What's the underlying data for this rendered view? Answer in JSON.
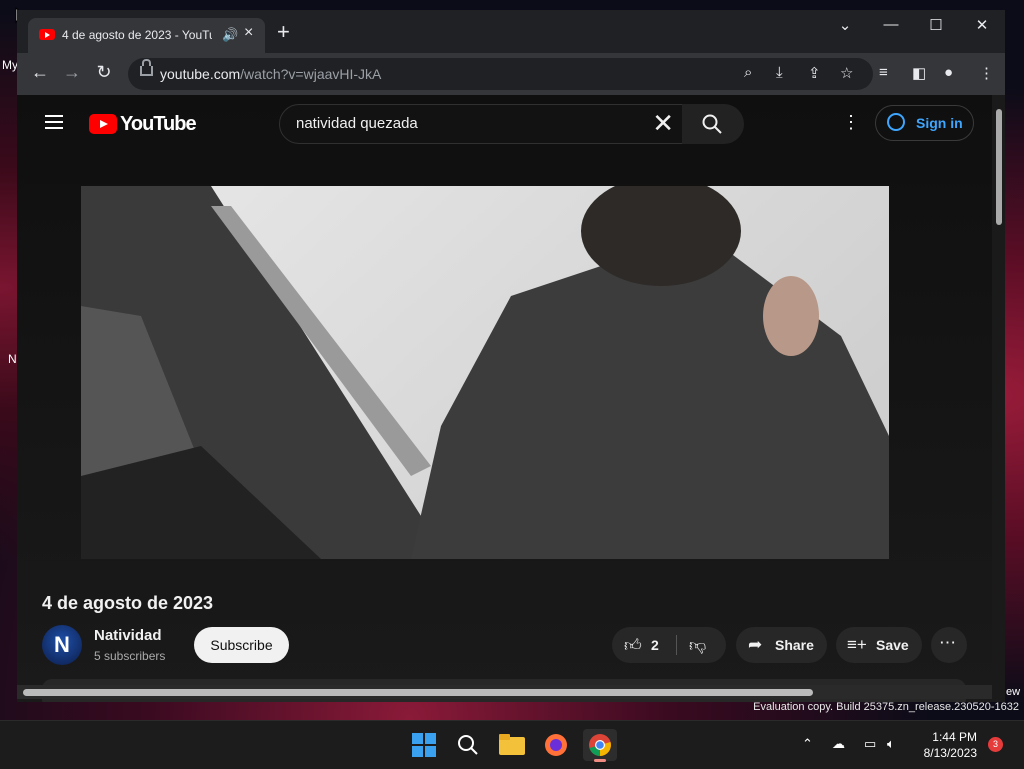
{
  "desktop": {
    "fragments": [
      "My",
      "N",
      "ew"
    ]
  },
  "browser": {
    "tab": {
      "title": "4 de agosto de 2023 - YouTube",
      "favicon": "youtube-favicon",
      "audio_icon": "speaker-icon"
    },
    "window_controls": {
      "dropdown": "⌄",
      "minimize": "—",
      "maximize": "☐",
      "close": "✕"
    },
    "url": {
      "host": "youtube.com",
      "path": "/watch?v=wjaavHI-JkA"
    }
  },
  "youtube": {
    "logo_text": "YouTube",
    "search": {
      "value": "natividad quezada"
    },
    "sign_in_label": "Sign in",
    "video": {
      "title": "4 de agosto de 2023",
      "channel": {
        "name": "Natividad",
        "avatar_letter": "N",
        "subscribers": "5 subscribers"
      },
      "subscribe_label": "Subscribe",
      "likes": "2",
      "share_label": "Share",
      "save_label": "Save"
    }
  },
  "watermark": "Evaluation copy. Build 25375.zn_release.230520-1632",
  "taskbar": {
    "time": "1:44 PM",
    "date": "8/13/2023",
    "notification_count": "3"
  },
  "colors": {
    "accent_link": "#3ea6ff",
    "youtube_red": "#ff0000",
    "tab_bg": "#35363a"
  }
}
